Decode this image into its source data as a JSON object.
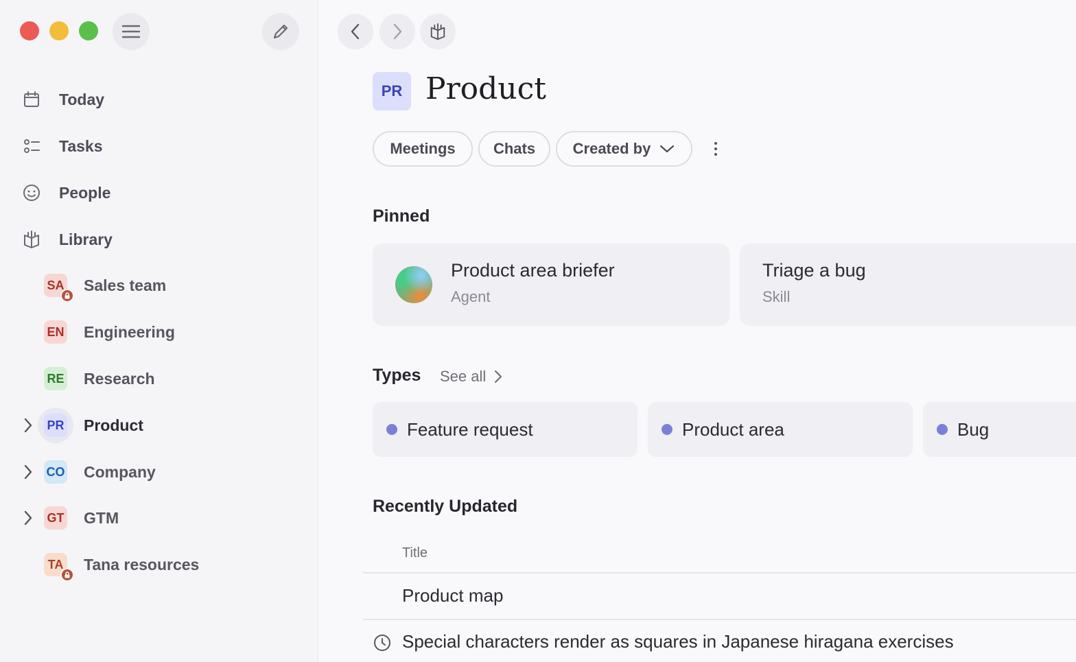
{
  "sidebar": {
    "nav": [
      {
        "label": "Today",
        "icon": "calendar-icon"
      },
      {
        "label": "Tasks",
        "icon": "tasks-icon"
      },
      {
        "label": "People",
        "icon": "people-icon"
      },
      {
        "label": "Library",
        "icon": "library-icon"
      }
    ],
    "spaces": [
      {
        "abbr": "SA",
        "label": "Sales team",
        "bg": "#f7d7d4",
        "fg": "#a8322a",
        "locked": true,
        "expandable": false,
        "active": false
      },
      {
        "abbr": "EN",
        "label": "Engineering",
        "bg": "#f7d7d4",
        "fg": "#a8322a",
        "locked": false,
        "expandable": false,
        "active": false
      },
      {
        "abbr": "RE",
        "label": "Research",
        "bg": "#d6efd4",
        "fg": "#2e7a2c",
        "locked": false,
        "expandable": false,
        "active": false
      },
      {
        "abbr": "PR",
        "label": "Product",
        "bg": "#dcdffb",
        "fg": "#3b44b8",
        "locked": false,
        "expandable": true,
        "active": true
      },
      {
        "abbr": "CO",
        "label": "Company",
        "bg": "#d4e8f8",
        "fg": "#1f5fa8",
        "locked": false,
        "expandable": true,
        "active": false
      },
      {
        "abbr": "GT",
        "label": "GTM",
        "bg": "#f7d7d4",
        "fg": "#a8322a",
        "locked": false,
        "expandable": true,
        "active": false
      },
      {
        "abbr": "TA",
        "label": "Tana resources",
        "bg": "#f9dccb",
        "fg": "#a8432a",
        "locked": true,
        "expandable": false,
        "active": false
      }
    ]
  },
  "page": {
    "avatar": "PR",
    "title": "Product",
    "filters": [
      "Meetings",
      "Chats",
      "Created by"
    ],
    "pinned_title": "Pinned",
    "pinned": [
      {
        "title": "Product area briefer",
        "subtitle": "Agent"
      },
      {
        "title": "Triage a bug",
        "subtitle": "Skill"
      }
    ],
    "types_title": "Types",
    "see_all": "See all",
    "types": [
      "Feature request",
      "Product area",
      "Bug"
    ],
    "recent_title": "Recently Updated",
    "column_title": "Title",
    "recent": [
      {
        "title": "Product map",
        "icon": ""
      },
      {
        "title": "Special characters render as squares in Japanese hiragana exercises",
        "icon": "clock-icon"
      }
    ]
  },
  "colors": {
    "accent_dot": "#7b80d6",
    "close": "#ec5a55",
    "minimize": "#f2bd3a",
    "zoom": "#5ac04b"
  }
}
